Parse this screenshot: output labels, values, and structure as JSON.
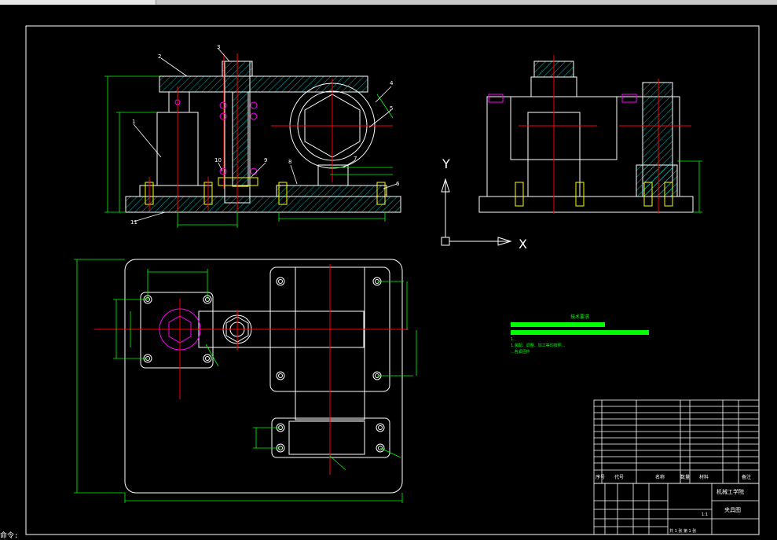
{
  "window": {
    "title": ""
  },
  "labels": {
    "balloons": [
      "1",
      "2",
      "3",
      "4",
      "5",
      "6",
      "7",
      "8",
      "9",
      "10",
      "11"
    ]
  },
  "axes_icon": {
    "y_label": "Y",
    "x_label": "X"
  },
  "notes": {
    "title": "技术要求",
    "line1": "1.",
    "line2": "1.装配、调整、加工等均按照...",
    "line3": "...各紧固件"
  },
  "title_block": {
    "company": "机械工学院",
    "drawing_name": "夹具图",
    "scale": "1:1",
    "sheet": "共 1 张  第 1 张",
    "bom_headers": [
      "序号",
      "代号",
      "名称",
      "数量",
      "材料",
      "备注"
    ]
  },
  "command": {
    "prompt": "命令:"
  },
  "colors": {
    "background": "#000000",
    "outline": "#ffffff",
    "dimension": "#00ff00",
    "centerline": "#ff0000",
    "hatch": "#00ffff",
    "balloon_text": "#ffffff",
    "magenta": "#ff00ff",
    "yellow": "#ffff00"
  }
}
